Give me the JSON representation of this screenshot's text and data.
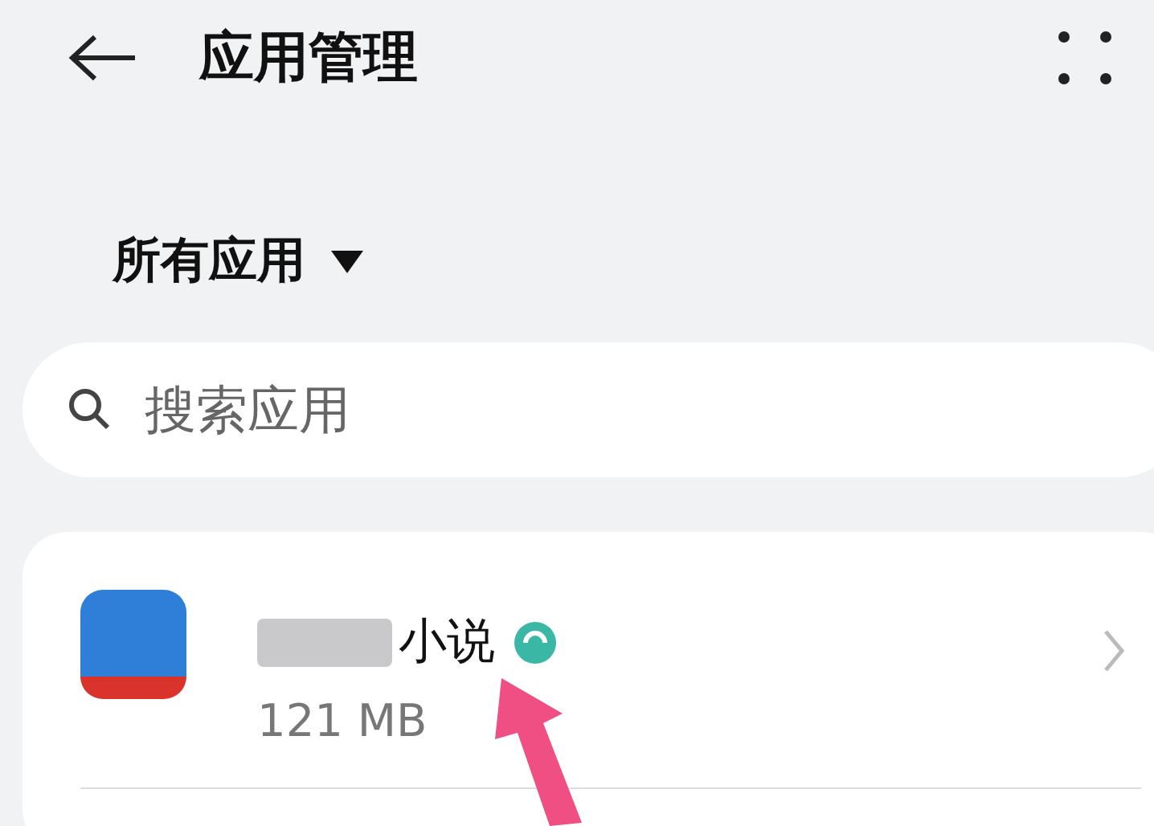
{
  "header": {
    "title": "应用管理"
  },
  "filter": {
    "label": "所有应用"
  },
  "search": {
    "placeholder": "搜索应用"
  },
  "apps": [
    {
      "name": "小说",
      "size": "121 MB",
      "verified": true
    }
  ]
}
